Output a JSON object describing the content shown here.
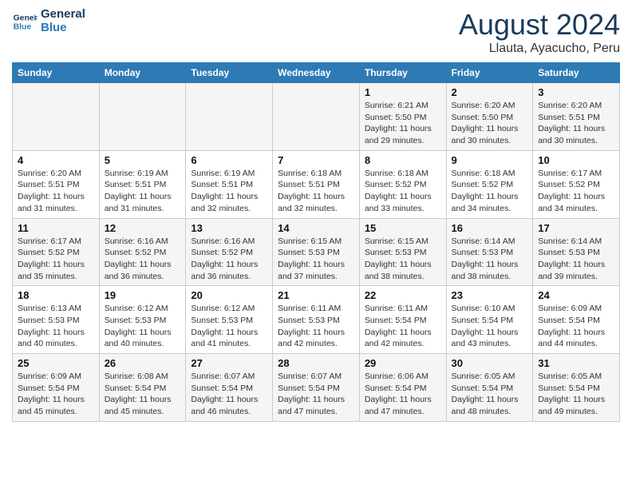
{
  "header": {
    "logo_line1": "General",
    "logo_line2": "Blue",
    "title": "August 2024",
    "subtitle": "Llauta, Ayacucho, Peru"
  },
  "days_of_week": [
    "Sunday",
    "Monday",
    "Tuesday",
    "Wednesday",
    "Thursday",
    "Friday",
    "Saturday"
  ],
  "weeks": [
    [
      {
        "day": "",
        "info": ""
      },
      {
        "day": "",
        "info": ""
      },
      {
        "day": "",
        "info": ""
      },
      {
        "day": "",
        "info": ""
      },
      {
        "day": "1",
        "info": "Sunrise: 6:21 AM\nSunset: 5:50 PM\nDaylight: 11 hours and 29 minutes."
      },
      {
        "day": "2",
        "info": "Sunrise: 6:20 AM\nSunset: 5:50 PM\nDaylight: 11 hours and 30 minutes."
      },
      {
        "day": "3",
        "info": "Sunrise: 6:20 AM\nSunset: 5:51 PM\nDaylight: 11 hours and 30 minutes."
      }
    ],
    [
      {
        "day": "4",
        "info": "Sunrise: 6:20 AM\nSunset: 5:51 PM\nDaylight: 11 hours and 31 minutes."
      },
      {
        "day": "5",
        "info": "Sunrise: 6:19 AM\nSunset: 5:51 PM\nDaylight: 11 hours and 31 minutes."
      },
      {
        "day": "6",
        "info": "Sunrise: 6:19 AM\nSunset: 5:51 PM\nDaylight: 11 hours and 32 minutes."
      },
      {
        "day": "7",
        "info": "Sunrise: 6:18 AM\nSunset: 5:51 PM\nDaylight: 11 hours and 32 minutes."
      },
      {
        "day": "8",
        "info": "Sunrise: 6:18 AM\nSunset: 5:52 PM\nDaylight: 11 hours and 33 minutes."
      },
      {
        "day": "9",
        "info": "Sunrise: 6:18 AM\nSunset: 5:52 PM\nDaylight: 11 hours and 34 minutes."
      },
      {
        "day": "10",
        "info": "Sunrise: 6:17 AM\nSunset: 5:52 PM\nDaylight: 11 hours and 34 minutes."
      }
    ],
    [
      {
        "day": "11",
        "info": "Sunrise: 6:17 AM\nSunset: 5:52 PM\nDaylight: 11 hours and 35 minutes."
      },
      {
        "day": "12",
        "info": "Sunrise: 6:16 AM\nSunset: 5:52 PM\nDaylight: 11 hours and 36 minutes."
      },
      {
        "day": "13",
        "info": "Sunrise: 6:16 AM\nSunset: 5:52 PM\nDaylight: 11 hours and 36 minutes."
      },
      {
        "day": "14",
        "info": "Sunrise: 6:15 AM\nSunset: 5:53 PM\nDaylight: 11 hours and 37 minutes."
      },
      {
        "day": "15",
        "info": "Sunrise: 6:15 AM\nSunset: 5:53 PM\nDaylight: 11 hours and 38 minutes."
      },
      {
        "day": "16",
        "info": "Sunrise: 6:14 AM\nSunset: 5:53 PM\nDaylight: 11 hours and 38 minutes."
      },
      {
        "day": "17",
        "info": "Sunrise: 6:14 AM\nSunset: 5:53 PM\nDaylight: 11 hours and 39 minutes."
      }
    ],
    [
      {
        "day": "18",
        "info": "Sunrise: 6:13 AM\nSunset: 5:53 PM\nDaylight: 11 hours and 40 minutes."
      },
      {
        "day": "19",
        "info": "Sunrise: 6:12 AM\nSunset: 5:53 PM\nDaylight: 11 hours and 40 minutes."
      },
      {
        "day": "20",
        "info": "Sunrise: 6:12 AM\nSunset: 5:53 PM\nDaylight: 11 hours and 41 minutes."
      },
      {
        "day": "21",
        "info": "Sunrise: 6:11 AM\nSunset: 5:53 PM\nDaylight: 11 hours and 42 minutes."
      },
      {
        "day": "22",
        "info": "Sunrise: 6:11 AM\nSunset: 5:54 PM\nDaylight: 11 hours and 42 minutes."
      },
      {
        "day": "23",
        "info": "Sunrise: 6:10 AM\nSunset: 5:54 PM\nDaylight: 11 hours and 43 minutes."
      },
      {
        "day": "24",
        "info": "Sunrise: 6:09 AM\nSunset: 5:54 PM\nDaylight: 11 hours and 44 minutes."
      }
    ],
    [
      {
        "day": "25",
        "info": "Sunrise: 6:09 AM\nSunset: 5:54 PM\nDaylight: 11 hours and 45 minutes."
      },
      {
        "day": "26",
        "info": "Sunrise: 6:08 AM\nSunset: 5:54 PM\nDaylight: 11 hours and 45 minutes."
      },
      {
        "day": "27",
        "info": "Sunrise: 6:07 AM\nSunset: 5:54 PM\nDaylight: 11 hours and 46 minutes."
      },
      {
        "day": "28",
        "info": "Sunrise: 6:07 AM\nSunset: 5:54 PM\nDaylight: 11 hours and 47 minutes."
      },
      {
        "day": "29",
        "info": "Sunrise: 6:06 AM\nSunset: 5:54 PM\nDaylight: 11 hours and 47 minutes."
      },
      {
        "day": "30",
        "info": "Sunrise: 6:05 AM\nSunset: 5:54 PM\nDaylight: 11 hours and 48 minutes."
      },
      {
        "day": "31",
        "info": "Sunrise: 6:05 AM\nSunset: 5:54 PM\nDaylight: 11 hours and 49 minutes."
      }
    ]
  ]
}
